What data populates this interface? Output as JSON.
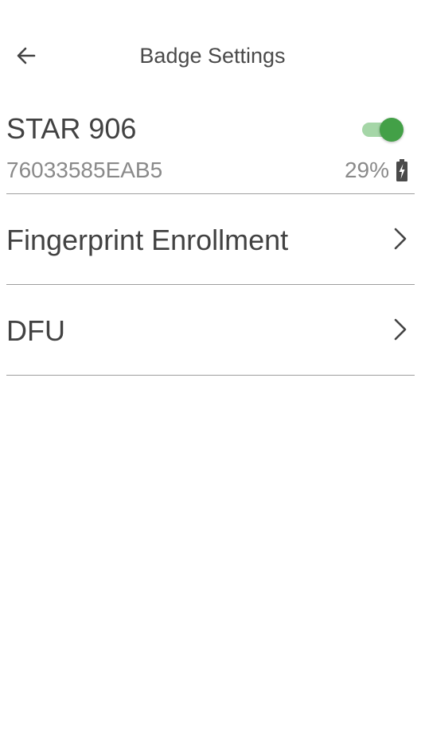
{
  "header": {
    "title": "Badge Settings"
  },
  "device": {
    "name": "STAR 906",
    "id": "76033585EAB5",
    "battery_percent": "29%",
    "enabled": true
  },
  "menu": {
    "items": [
      {
        "label": "Fingerprint Enrollment",
        "icon": "chevron-right-icon"
      },
      {
        "label": "DFU",
        "icon": "chevron-right-icon"
      }
    ]
  },
  "icons": {
    "back": "arrow-left-icon",
    "battery": "battery-charging-icon"
  },
  "colors": {
    "toggle_thumb": "#43a047",
    "toggle_track": "#a5d6a7",
    "divider": "#9e9e9e"
  }
}
